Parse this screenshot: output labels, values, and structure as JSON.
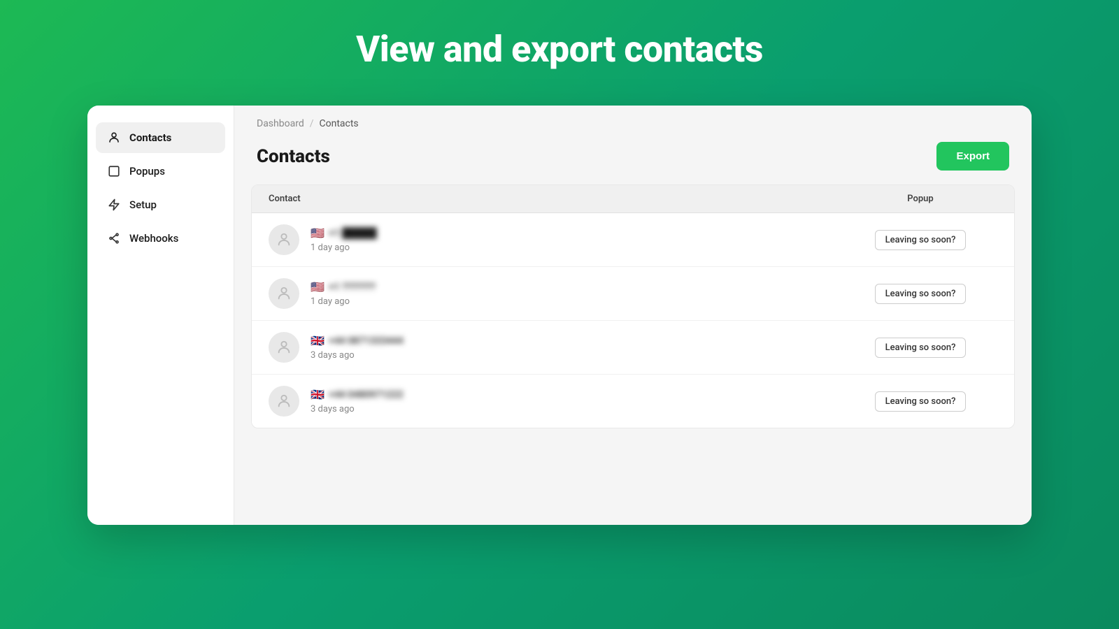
{
  "hero": {
    "title": "View and export contacts"
  },
  "sidebar": {
    "items": [
      {
        "id": "contacts",
        "label": "Contacts",
        "icon": "person",
        "active": true
      },
      {
        "id": "popups",
        "label": "Popups",
        "icon": "square",
        "active": false
      },
      {
        "id": "setup",
        "label": "Setup",
        "icon": "bolt",
        "active": false
      },
      {
        "id": "webhooks",
        "label": "Webhooks",
        "icon": "webhook",
        "active": false
      }
    ]
  },
  "breadcrumb": {
    "home": "Dashboard",
    "separator": "/",
    "current": "Contacts"
  },
  "page": {
    "title": "Contacts",
    "export_button": "Export"
  },
  "table": {
    "headers": {
      "contact": "Contact",
      "popup": "Popup"
    },
    "rows": [
      {
        "flag": "🇺🇸",
        "phone": "+1 █████",
        "time": "1 day ago",
        "popup": "Leaving so soon?"
      },
      {
        "flag": "🇺🇸",
        "phone": "+1 ???????",
        "time": "1 day ago",
        "popup": "Leaving so soon?"
      },
      {
        "flag": "🇬🇧",
        "phone": "+44 0871333444",
        "time": "3 days ago",
        "popup": "Leaving so soon?"
      },
      {
        "flag": "🇬🇧",
        "phone": "+44 0480971222",
        "time": "3 days ago",
        "popup": "Leaving so soon?"
      }
    ]
  },
  "icons": {
    "person": "&#9900;",
    "square": "&#9633;",
    "bolt": "&#9889;",
    "webhook": "&#9880;"
  }
}
